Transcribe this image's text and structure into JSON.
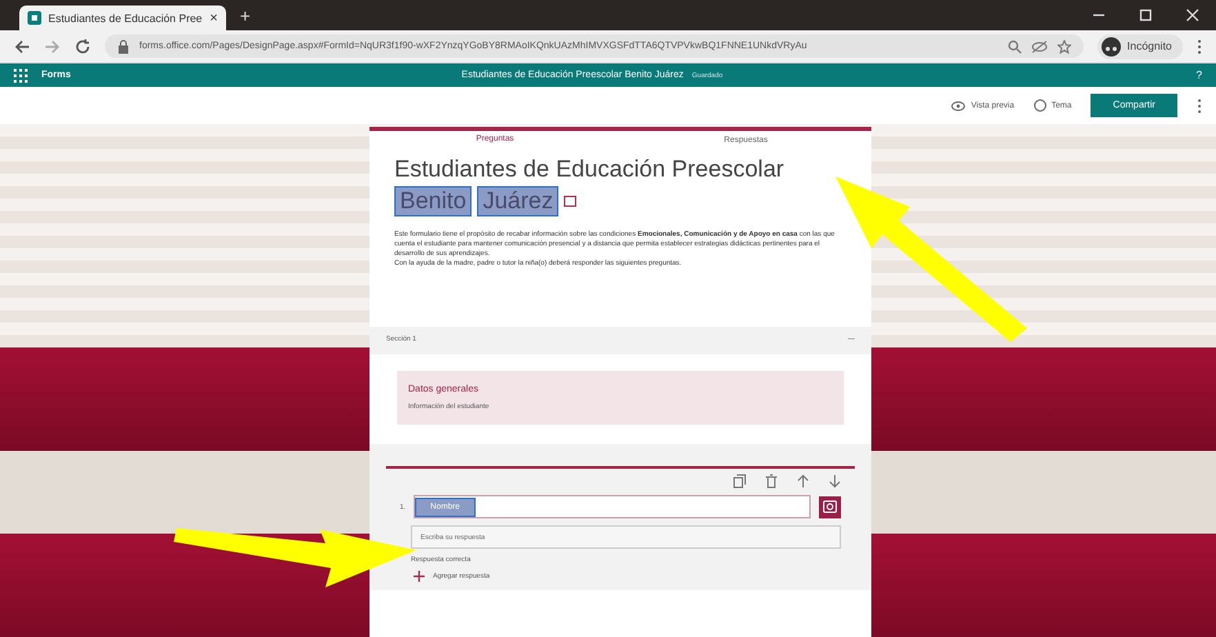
{
  "browser": {
    "tab_title": "Estudiantes de Educación Pree",
    "tab_close": "×",
    "new_tab": "+",
    "url": "forms.office.com/Pages/DesignPage.aspx#FormId=NqUR3f1f90-wXF2YnzqYGoBY8RMAoIKQnkUAzMhIMVXGSFdTTA6QTVPVkwBQ1FNNE1UNkdVRyAu",
    "profile": "Incógnito"
  },
  "app_bar": {
    "app_name": "Forms",
    "doc_title": "Estudiantes de Educación Preescolar Benito Juárez",
    "save_state": "Guardado",
    "help": "?"
  },
  "toolbar": {
    "preview": "Vista previa",
    "theme": "Tema",
    "share": "Compartir"
  },
  "tabs": [
    {
      "label": "Preguntas",
      "selected": true
    },
    {
      "label": "Respuestas",
      "selected": false
    }
  ],
  "form": {
    "title_parts": [
      {
        "text": "Estudiantes de Educación Preescolar",
        "highlighted": false
      },
      {
        "text": "Benito",
        "highlighted": true
      },
      {
        "text": "Juárez",
        "highlighted": true
      }
    ],
    "description": [
      "Este formulario tiene el propósito de recabar información sobre las condiciones **Emocionales, Comunicación y de Apoyo en casa** con las que cuenta el estudiante para mantener comunicación presencial y a distancia que permita establecer estrategias didácticas pertinentes para el desarrollo de sus aprendizajes.",
      "Con la ayuda de la madre, padre o tutor la niña(o) deberá responder las siguientes preguntas."
    ]
  },
  "section": {
    "label": "Sección 1",
    "collapse": "—",
    "heading": "Datos generales",
    "subheading": "Información del estudiante"
  },
  "question": {
    "number": "1.",
    "title": "Nombre",
    "highlighted": true,
    "placeholder": "Escriba su respuesta",
    "correct_label": "Respuesta correcta",
    "add_answer": "Agregar respuesta"
  }
}
